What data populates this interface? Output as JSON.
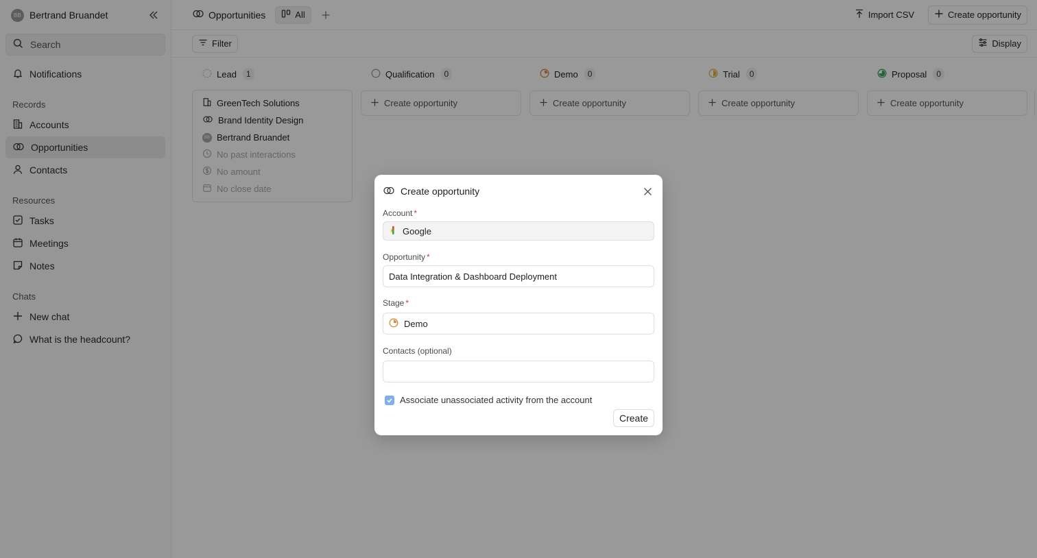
{
  "sidebar": {
    "user": {
      "initials": "BB",
      "name": "Bertrand Bruandet"
    },
    "search_placeholder": "Search",
    "notifications": "Notifications",
    "records_label": "Records",
    "records": [
      "Accounts",
      "Opportunities",
      "Contacts"
    ],
    "resources_label": "Resources",
    "resources": [
      "Tasks",
      "Meetings",
      "Notes"
    ],
    "chats_label": "Chats",
    "chats": [
      "New chat",
      "What is the headcount?"
    ]
  },
  "topbar": {
    "title": "Opportunities",
    "view": "All",
    "import_csv": "Import CSV",
    "create_opportunity": "Create opportunity"
  },
  "filterbar": {
    "filter": "Filter",
    "display": "Display"
  },
  "board": {
    "columns": [
      {
        "name": "Lead",
        "count": "1",
        "color": "#bdbdbd"
      },
      {
        "name": "Qualification",
        "count": "0",
        "color": "#9e9e9e"
      },
      {
        "name": "Demo",
        "count": "0",
        "color": "#d98b3a"
      },
      {
        "name": "Trial",
        "count": "0",
        "color": "#e3b341"
      },
      {
        "name": "Proposal",
        "count": "0",
        "color": "#3aa55d"
      }
    ],
    "create_label": "Create opportunity",
    "card": {
      "account": "GreenTech Solutions",
      "opportunity": "Brand Identity Design",
      "owner_initials": "BB",
      "owner": "Bertrand Bruandet",
      "interactions": "No past interactions",
      "amount": "No amount",
      "close_date": "No close date"
    }
  },
  "modal": {
    "title": "Create opportunity",
    "account_label": "Account",
    "account_value": "Google",
    "opportunity_label": "Opportunity",
    "opportunity_value": "Data Integration & Dashboard Deployment",
    "stage_label": "Stage",
    "stage_value": "Demo",
    "contacts_label": "Contacts (optional)",
    "contacts_value": "",
    "associate_label": "Associate unassociated activity from the account",
    "associate_checked": true,
    "create_button": "Create",
    "required_mark": "*"
  }
}
